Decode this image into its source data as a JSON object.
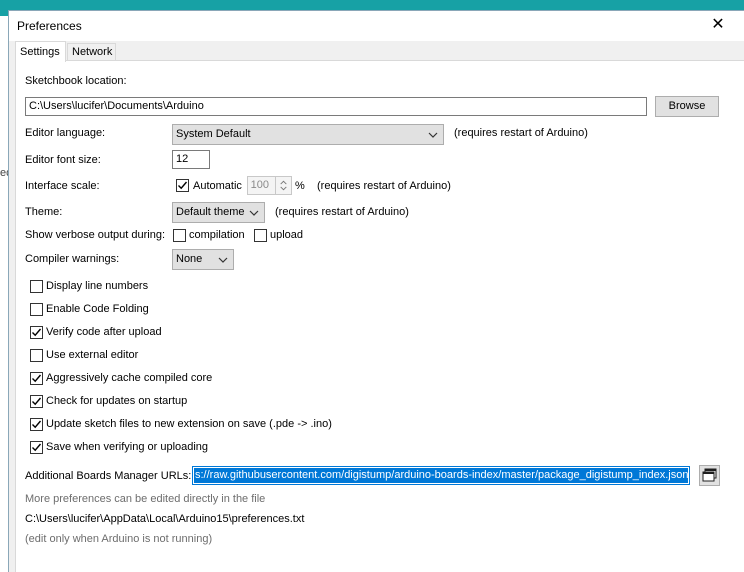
{
  "background": {
    "partial_text": "ed",
    "accent_color": "#17a1a5"
  },
  "window": {
    "title": "Preferences",
    "close_glyph": "✕"
  },
  "tabs": [
    {
      "label": "Settings",
      "active": true
    },
    {
      "label": "Network",
      "active": false
    }
  ],
  "settings": {
    "sketchbook": {
      "label": "Sketchbook location:",
      "value": "C:\\Users\\lucifer\\Documents\\Arduino",
      "browse_label": "Browse"
    },
    "editor_language": {
      "label": "Editor language:",
      "value": "System Default",
      "note": "(requires restart of Arduino)"
    },
    "editor_font_size": {
      "label": "Editor font size:",
      "value": "12"
    },
    "interface_scale": {
      "label": "Interface scale:",
      "automatic_label": "Automatic",
      "automatic_checked": true,
      "value": "100",
      "unit": "%",
      "note": "(requires restart of Arduino)"
    },
    "theme": {
      "label": "Theme:",
      "value": "Default theme",
      "note": "(requires restart of Arduino)"
    },
    "verbose": {
      "label": "Show verbose output during:",
      "compilation_label": "compilation",
      "compilation_checked": false,
      "upload_label": "upload",
      "upload_checked": false
    },
    "compiler_warnings": {
      "label": "Compiler warnings:",
      "value": "None"
    },
    "options": [
      {
        "label": "Display line numbers",
        "checked": false
      },
      {
        "label": "Enable Code Folding",
        "checked": false
      },
      {
        "label": "Verify code after upload",
        "checked": true
      },
      {
        "label": "Use external editor",
        "checked": false
      },
      {
        "label": "Aggressively cache compiled core",
        "checked": true
      },
      {
        "label": "Check for updates on startup",
        "checked": true
      },
      {
        "label": "Update sketch files to new extension on save (.pde -> .ino)",
        "checked": true
      },
      {
        "label": "Save when verifying or uploading",
        "checked": true
      }
    ],
    "boards_urls": {
      "label": "Additional Boards Manager URLs:",
      "value": "s://raw.githubusercontent.com/digistump/arduino-boards-index/master/package_digistump_index.json"
    },
    "more_prefs_note": "More preferences can be edited directly in the file",
    "prefs_path": "C:\\Users\\lucifer\\AppData\\Local\\Arduino15\\preferences.txt",
    "edit_note": "(edit only when Arduino is not running)"
  }
}
